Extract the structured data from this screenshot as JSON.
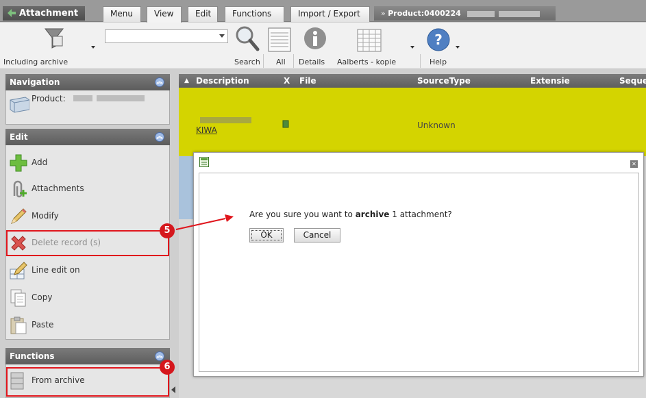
{
  "tabbar": {
    "app_title": "Attachment",
    "tabs": [
      "Menu",
      "View",
      "Edit",
      "Functions",
      "Import / Export"
    ],
    "breadcrumb_prefix": "» ",
    "breadcrumb_product": "Product:",
    "breadcrumb_id": "0400224"
  },
  "toolbar": {
    "including_archive_label": "Including archive",
    "search_label": "Search",
    "all_label": "All",
    "details_label": "Details",
    "layout_label": "Aalberts - kopie",
    "help_label": "Help",
    "search_value": ""
  },
  "navigation": {
    "title": "Navigation",
    "product_label": "Product:"
  },
  "edit_section": {
    "title": "Edit",
    "items": [
      {
        "label": "Add",
        "icon": "plus-icon",
        "enabled": true
      },
      {
        "label": "Attachments",
        "icon": "paperclip-icon",
        "enabled": true
      },
      {
        "label": "Modify",
        "icon": "pencil-icon",
        "enabled": true
      },
      {
        "label": "Delete record (s)",
        "icon": "delete-x-icon",
        "enabled": false
      },
      {
        "label": "Line edit on",
        "icon": "line-edit-icon",
        "enabled": true
      },
      {
        "label": "Copy",
        "icon": "copy-icon",
        "enabled": true
      },
      {
        "label": "Paste",
        "icon": "paste-icon",
        "enabled": true
      }
    ]
  },
  "functions_section": {
    "title": "Functions",
    "items": [
      {
        "label": "From archive",
        "icon": "archive-icon"
      }
    ]
  },
  "grid": {
    "columns": [
      "Description",
      "X",
      "File",
      "SourceType",
      "Extensie",
      "Seque"
    ],
    "rows": [
      {
        "description": "KIWA",
        "source_type": "Unknown"
      }
    ],
    "row_color": "#d4d400"
  },
  "dialog": {
    "message_prefix": "Are you sure you want to ",
    "message_bold": "archive",
    "message_suffix": " 1 attachment?",
    "ok_label": "OK",
    "cancel_label": "Cancel"
  },
  "annotations": {
    "badge_5": "5",
    "badge_6": "6",
    "color": "#e0151c"
  }
}
